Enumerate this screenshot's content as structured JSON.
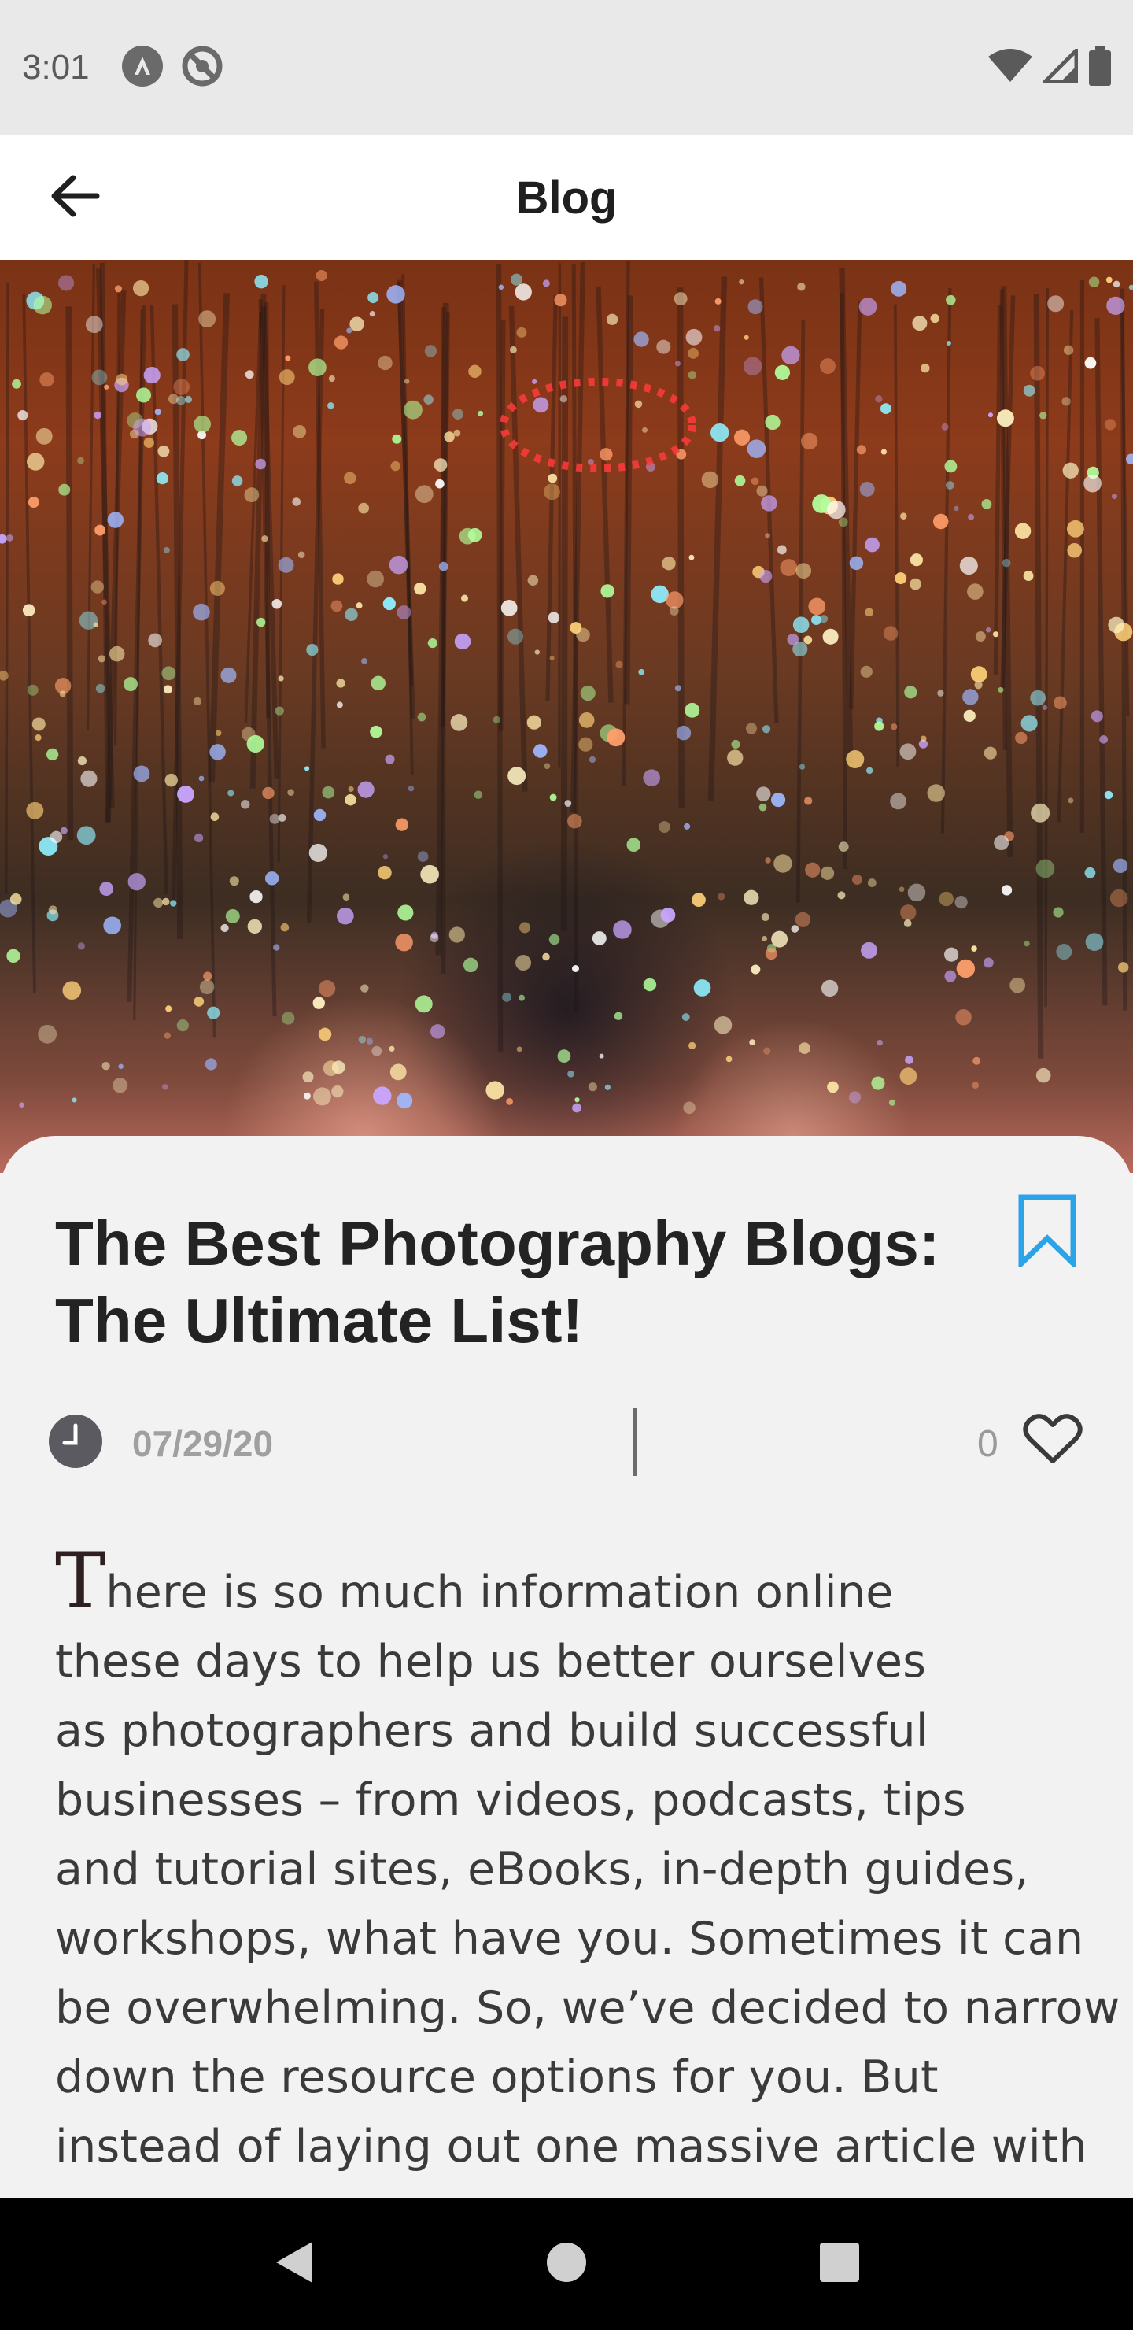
{
  "status_bar": {
    "time": "3:01",
    "left_icons": [
      "app-notification-icon",
      "sync-disabled-icon"
    ],
    "right_icons": [
      "wifi-icon",
      "cellular-signal-icon",
      "battery-icon"
    ]
  },
  "app_bar": {
    "back_icon": "arrow-back-icon",
    "title": "Blog"
  },
  "hero": {
    "image": "sparkling-hanging-lights-photo"
  },
  "post": {
    "title_line1": "The Best Photography Blogs:",
    "title_line2": "The Ultimate List!",
    "bookmark_icon": "bookmark-outline-icon",
    "bookmark_color": "#2ca3e6",
    "date": "07/29/20",
    "like_count": "0",
    "like_icon": "heart-outline-icon",
    "body_dropcap": "T",
    "body_lines": [
      "here is so much information online",
      "these days to help us better ourselves",
      "as photographers and build successful",
      "businesses – from videos, podcasts, tips",
      "and tutorial sites, eBooks, in-depth guides,",
      "workshops, what have you. Sometimes it can",
      "be overwhelming. So, we’ve decided to narrow",
      "down the resource options for you. But",
      "instead of laying out one massive article with"
    ]
  },
  "nav_bar": {
    "buttons": [
      "back-triangle-icon",
      "home-circle-icon",
      "recents-square-icon"
    ]
  }
}
